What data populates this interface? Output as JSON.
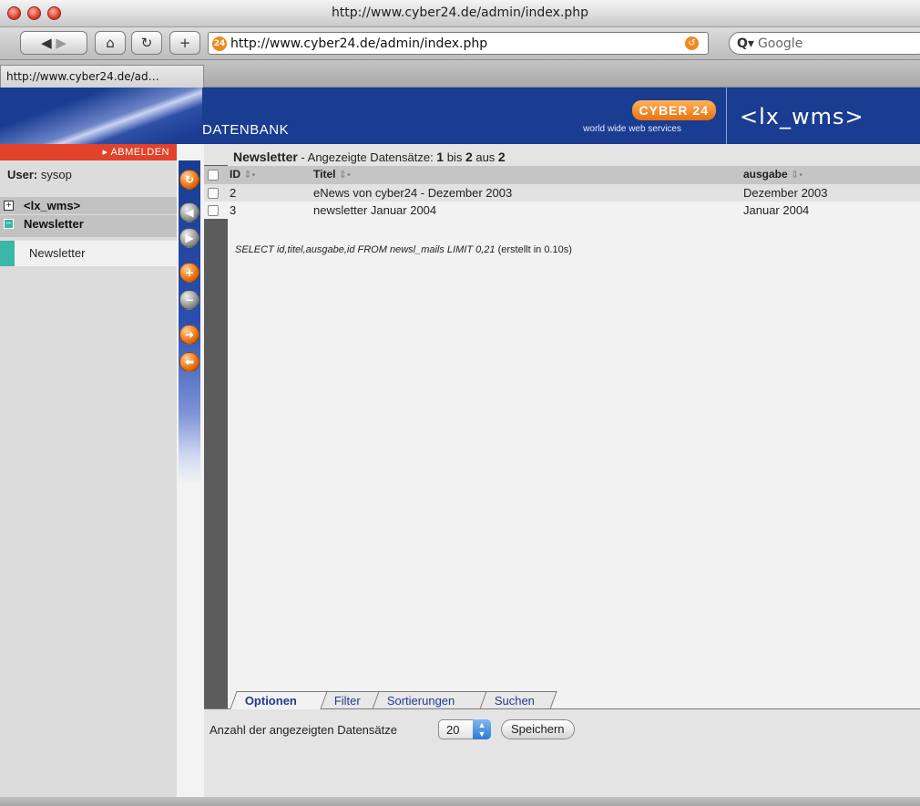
{
  "browser": {
    "window_title": "http://www.cyber24.de/admin/index.php",
    "url": "http://www.cyber24.de/admin/index.php",
    "search_placeholder": "Google",
    "tab_title": "http://www.cyber24.de/ad…"
  },
  "header": {
    "section": "DATENBANK",
    "logo": "CYBER 24",
    "logo_sub": "world wide web services",
    "app_name": "<lx_wms>"
  },
  "sidebar": {
    "logout": "ABMELDEN",
    "user_label": "User:",
    "user_name": "sysop",
    "tree": [
      {
        "label": "<lx_wms>",
        "toggle": "+"
      },
      {
        "label": "Newsletter",
        "toggle": "−"
      }
    ],
    "active_item": "Newsletter"
  },
  "content": {
    "title": "Newsletter",
    "summary_prefix": " - Angezeigte Datensätze: ",
    "from": "1",
    "to_label": " bis ",
    "to": "2",
    "of_label": " aus ",
    "total": "2",
    "columns": [
      "ID",
      "Titel",
      "ausgabe"
    ],
    "rows": [
      {
        "id": "2",
        "title": "eNews von cyber24 - Dezember 2003",
        "ausgabe": "Dezember 2003"
      },
      {
        "id": "3",
        "title": "newsletter Januar 2004",
        "ausgabe": "Januar 2004"
      }
    ],
    "sql": "SELECT id,titel,ausgabe,id FROM newsl_mails LIMIT 0,21",
    "sql_time": "(erstellt in 0.10s)"
  },
  "options": {
    "tabs": [
      "Optionen",
      "Filter",
      "Sortierungen",
      "Suchen"
    ],
    "records_label": "Anzahl der angezeigten Datensätze",
    "records_value": "20",
    "save_label": "Speichern"
  }
}
